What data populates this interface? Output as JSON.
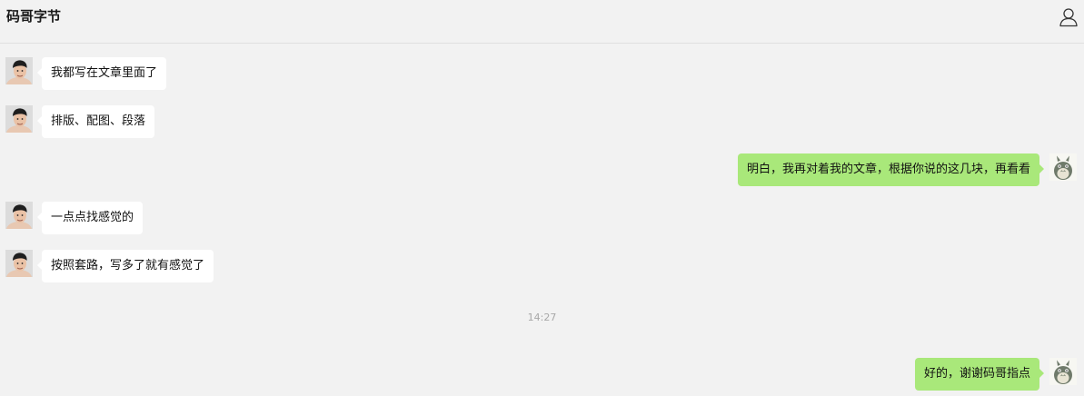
{
  "header": {
    "title": "码哥字节",
    "profile_icon": "user-profile-icon"
  },
  "messages": [
    {
      "side": "left",
      "text": "我都写在文章里面了",
      "avatar": "person-photo-avatar"
    },
    {
      "side": "left",
      "text": "排版、配图、段落",
      "avatar": "person-photo-avatar"
    },
    {
      "side": "right",
      "text": "明白，我再对着我的文章，根据你说的这几块，再看看",
      "avatar": "totoro-avatar"
    },
    {
      "side": "left",
      "text": "一点点找感觉的",
      "avatar": "person-photo-avatar"
    },
    {
      "side": "left",
      "text": "按照套路，写多了就有感觉了",
      "avatar": "person-photo-avatar"
    },
    {
      "side": "right",
      "text": "好的，谢谢码哥指点",
      "avatar": "totoro-avatar"
    }
  ],
  "timestamp": "14:27",
  "colors": {
    "background": "#f2f2f2",
    "received_bubble": "#ffffff",
    "sent_bubble": "#a9e87a"
  }
}
